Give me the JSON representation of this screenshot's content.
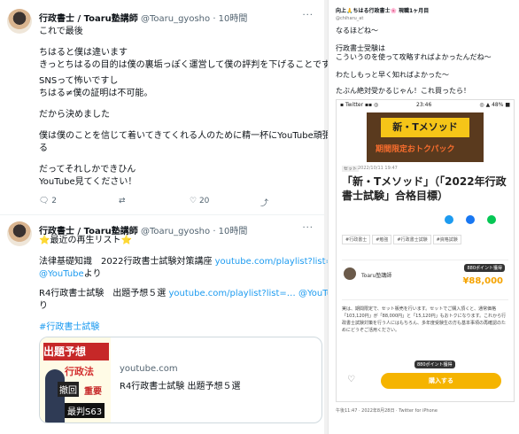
{
  "tweet1": {
    "name": "行政書士 / Toaru塾講師",
    "handle": "@Toaru_gyosho",
    "time": "· 10時間",
    "more": "···",
    "lines": [
      "これで最後",
      "",
      "ちはると僕は違います",
      "きっとちはるの目的は僕の裏垢っぽく運営して僕の評判を下げることです",
      "",
      "SNSって怖いですし",
      "ちはる≠僕の証明は不可能。",
      "",
      "だから決めました",
      "",
      "僕は僕のことを信じて着いてきてくれる人のために精一杯にYouTube頑張",
      "る",
      "",
      "だってそれしかできひん",
      "YouTube見てください！"
    ],
    "actions": {
      "reply": "2",
      "retweet": "",
      "like": "20",
      "share": ""
    }
  },
  "tweet2": {
    "name": "行政書士 / Toaru塾講師",
    "handle": "@Toaru_gyosho",
    "time": "· 10時間",
    "more": "···",
    "line1": "⭐最近の再生リスト⭐",
    "line2_text": "法律基礎知識　2022行政書士試験対策講座 ",
    "line2_link": "youtube.com/playlist?list=…",
    "line3_link": "@YouTube",
    "line3_text": "より",
    "line4_text": "R4行政書士試験　出題予想５選 ",
    "line4_link": "youtube.com/playlist?list=…",
    "line4_link2": " @YouTube",
    "line4_tail": "よ",
    "line5": "り",
    "hashtag": "#行政書士試験",
    "card": {
      "thumb_1": "出題予想",
      "thumb_2": "行政法",
      "thumb_3": "撤回",
      "thumb_4": "重要",
      "thumb_5": "最判S63",
      "domain": "youtube.com",
      "title": "R4行政書士試験 出題予想５選"
    }
  },
  "right": {
    "rt_header": "向上🙏ちはる行政書士🌸 現職1ヶ月目",
    "rt_handle": "@chiharu_at",
    "lines": [
      "なるほどね〜",
      "",
      "行政書士受験は",
      "こういうのを使って攻略すればよかったんだね〜",
      "",
      "わたしもっと早く知ればよかった〜",
      "",
      "たぶん絶対受かるじゃん！これ買ったら！"
    ],
    "shot": {
      "status_left": "▪ Twitter ▪▪ ◎",
      "status_time": "23:46",
      "status_right": "◎ ▲ 48% ■",
      "banner_title": "新・Tメソッド",
      "banner_sub": "期間限定おトクパック",
      "tag": "セット",
      "date": "2022/10/11 19:47",
      "title": "「新・Tメソッド」（「2022年行政書士試験」合格目標）",
      "chips": [
        "#行政書士",
        "#勉強",
        "#行政書士試験",
        "#資格試験"
      ],
      "author": "Toaru塾講師",
      "point_badge": "880ポイント獲得",
      "price": "¥88,000",
      "body": "実は、期間限定で、セット販売を行います。セットでご購入頂くと、通常価格「103,120円」が「88,000円」と「15,120円」もおトクになります。これから行政書士試験対策を行う人にはもちろん、多年度受験生の方も基本事項の再確認のためにどうぞご活用ください。",
      "point_badge2": "880ポイント獲得",
      "heart": "♡",
      "buy": "購入する"
    },
    "footer": "午後11:47 · 2022年8月28日 · Twitter for iPhone"
  },
  "colors": {
    "link": "#1d9bf0",
    "buy": "#f5b400"
  },
  "icons": [
    "reply-icon",
    "retweet-icon",
    "like-icon",
    "share-icon"
  ]
}
